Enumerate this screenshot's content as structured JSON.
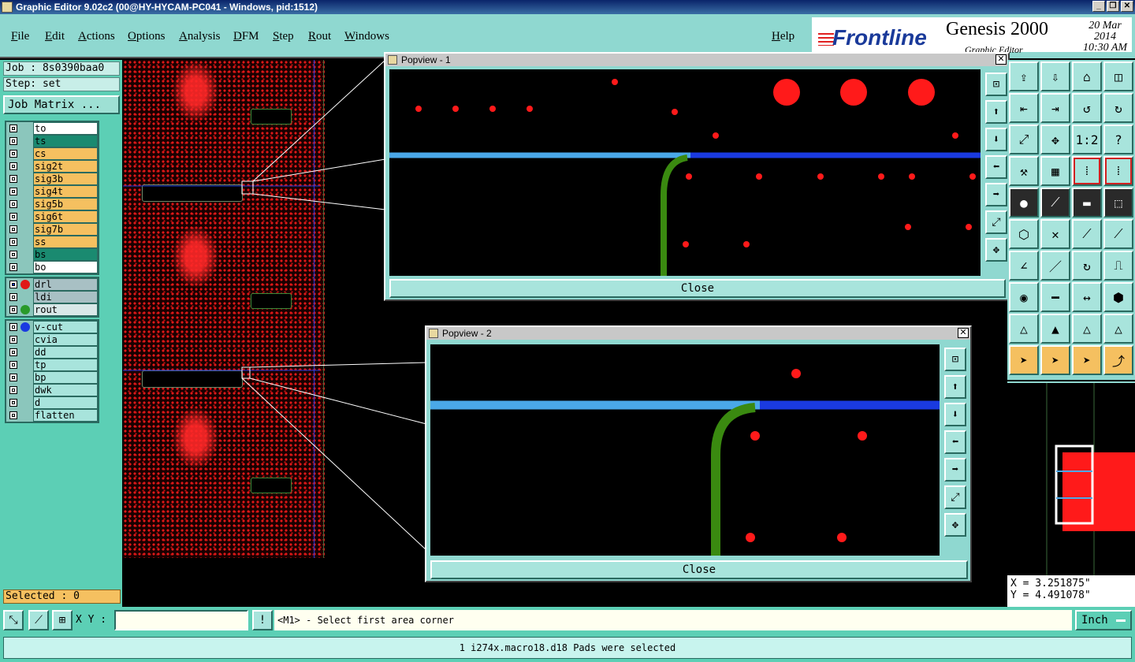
{
  "window": {
    "title": "Graphic Editor 9.02c2 (00@HY-HYCAM-PC041 - Windows, pid:1512)"
  },
  "menu": [
    "File",
    "Edit",
    "Actions",
    "Options",
    "Analysis",
    "DFM",
    "Step",
    "Rout",
    "Windows"
  ],
  "help_label": "Help",
  "brand": {
    "logo": "Frontline",
    "product": "Genesis 2000",
    "subtitle": "Graphic Editor",
    "date": "20 Mar 2014",
    "time": "10:30 AM"
  },
  "job": {
    "job_label": "Job : 8s0390baa0",
    "step_label": "Step: set",
    "matrix_button": "Job Matrix ..."
  },
  "layers_group1": [
    {
      "name": "to",
      "color": "#ffffff"
    },
    {
      "name": "ts",
      "color": "#1a8a70"
    },
    {
      "name": "cs",
      "color": "#f5c060"
    },
    {
      "name": "sig2t",
      "color": "#f5c060"
    },
    {
      "name": "sig3b",
      "color": "#f5c060"
    },
    {
      "name": "sig4t",
      "color": "#f5c060"
    },
    {
      "name": "sig5b",
      "color": "#f5c060"
    },
    {
      "name": "sig6t",
      "color": "#f5c060"
    },
    {
      "name": "sig7b",
      "color": "#f5c060"
    },
    {
      "name": "ss",
      "color": "#f5c060"
    },
    {
      "name": "bs",
      "color": "#1a8a70"
    },
    {
      "name": "bo",
      "color": "#ffffff"
    }
  ],
  "layers_group2": [
    {
      "name": "drl",
      "color": "#a8c0c4",
      "dot": "#e01818",
      "active": true
    },
    {
      "name": "ldi",
      "color": "#a8c0c4"
    },
    {
      "name": "rout",
      "color": "#d8e8e8",
      "dot": "#2a9a2a"
    }
  ],
  "layers_group3": [
    {
      "name": "v-cut",
      "color": "#a8e4dc",
      "dot": "#1a3ae0"
    },
    {
      "name": "cvia",
      "color": "#a8e4dc"
    },
    {
      "name": "dd",
      "color": "#a8e4dc"
    },
    {
      "name": "tp",
      "color": "#a8e4dc"
    },
    {
      "name": "bp",
      "color": "#a8e4dc"
    },
    {
      "name": "dwk",
      "color": "#a8e4dc"
    },
    {
      "name": "d",
      "color": "#a8e4dc"
    },
    {
      "name": "flatten",
      "color": "#a8e4dc"
    }
  ],
  "selected_label": "Selected : 0",
  "popview1": {
    "title": "Popview - 1",
    "close_label": "Close"
  },
  "popview2": {
    "title": "Popview - 2",
    "close_label": "Close"
  },
  "coords": {
    "x": "X = 3.251875\"",
    "y": "Y = 4.491078\""
  },
  "command": {
    "xy_label": "X Y :",
    "xy_value": "",
    "prompt": "<M1> - Select first area corner",
    "unit": "Inch"
  },
  "status_message": "1 i274x.macro18.d18 Pads were selected",
  "colors": {
    "accent": "#5ccfb5",
    "panel": "#8fd8d0",
    "pad": "#ff1a1a",
    "trace_light": "#4aa8e8",
    "trace_dark": "#1a3ae0",
    "rout": "#3a8a10"
  }
}
